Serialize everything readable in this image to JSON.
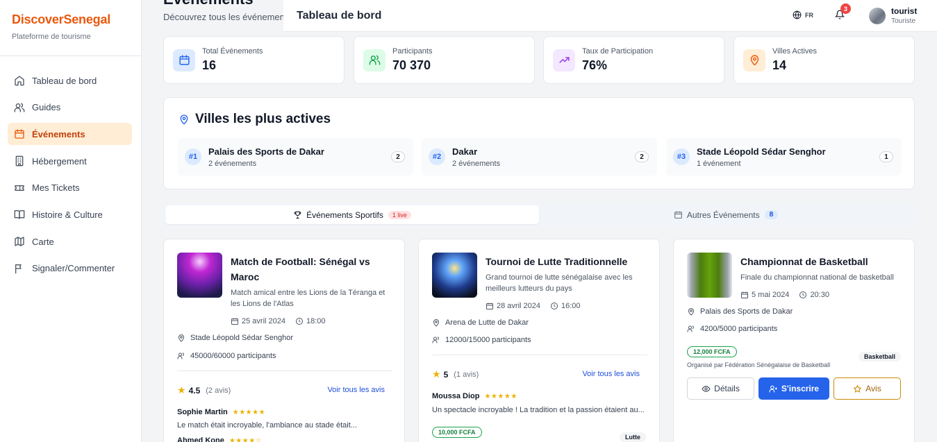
{
  "brand": {
    "title": "DiscoverSenegal",
    "subtitle": "Plateforme de tourisme"
  },
  "sidebar": {
    "items": [
      {
        "label": "Tableau de bord",
        "icon": "home-icon",
        "active": false
      },
      {
        "label": "Guides",
        "icon": "users-icon",
        "active": false
      },
      {
        "label": "Événements",
        "icon": "calendar-icon",
        "active": true
      },
      {
        "label": "Hébergement",
        "icon": "building-icon",
        "active": false
      },
      {
        "label": "Mes Tickets",
        "icon": "ticket-icon",
        "active": false
      },
      {
        "label": "Histoire & Culture",
        "icon": "book-icon",
        "active": false
      },
      {
        "label": "Carte",
        "icon": "map-icon",
        "active": false
      },
      {
        "label": "Signaler/Commenter",
        "icon": "flag-icon",
        "active": false
      }
    ]
  },
  "page": {
    "title": "Événements",
    "subtitle": "Découvrez tous les événements"
  },
  "header": {
    "title": "Tableau de bord",
    "language": "FR",
    "notifications": "3",
    "user": {
      "name": "tourist",
      "role": "Touriste"
    }
  },
  "stats": [
    {
      "label": "Total Événements",
      "value": "16",
      "icon": "calendar-icon",
      "color": "#2563eb",
      "bg": "#dbeafe"
    },
    {
      "label": "Participants",
      "value": "70 370",
      "icon": "users-icon",
      "color": "#16a34a",
      "bg": "#dcfce7"
    },
    {
      "label": "Taux de Participation",
      "value": "76%",
      "icon": "trending-up-icon",
      "color": "#9333ea",
      "bg": "#f3e8ff"
    },
    {
      "label": "Villes Actives",
      "value": "14",
      "icon": "map-pin-icon",
      "color": "#ea580c",
      "bg": "#ffedd5"
    }
  ],
  "cities": {
    "title": "Villes les plus actives",
    "items": [
      {
        "rank": "#1",
        "name": "Palais des Sports de Dakar",
        "events": "2 événements",
        "count": "2"
      },
      {
        "rank": "#2",
        "name": "Dakar",
        "events": "2 événements",
        "count": "2"
      },
      {
        "rank": "#3",
        "name": "Stade Léopold Sédar Senghor",
        "events": "1 événement",
        "count": "1"
      }
    ]
  },
  "tabs": {
    "sports": {
      "label": "Événements Sportifs",
      "badge": "1 live"
    },
    "others": {
      "label": "Autres Événements",
      "badge": "8"
    }
  },
  "events": [
    {
      "title": "Match de Football: Sénégal vs Maroc",
      "description": "Match amical entre les Lions de la Téranga et les Lions de l'Atlas",
      "date": "25 avril 2024",
      "time": "18:00",
      "venue": "Stade Léopold Sédar Senghor",
      "participants": "45000/60000 participants",
      "rating": "4.5",
      "reviews_count": "(2 avis)",
      "see_all": "Voir tous les avis",
      "reviews": [
        {
          "name": "Sophie Martin",
          "stars": "★★★★★",
          "text": "Le match était incroyable, l'ambiance au stade était..."
        },
        {
          "name": "Ahmed Kone",
          "stars": "★★★★☆",
          "text": ""
        }
      ]
    },
    {
      "title": "Tournoi de Lutte Traditionnelle",
      "description": "Grand tournoi de lutte sénégalaise avec les meilleurs lutteurs du pays",
      "date": "28 avril 2024",
      "time": "16:00",
      "venue": "Arena de Lutte de Dakar",
      "participants": "12000/15000 participants",
      "rating": "5",
      "reviews_count": "(1 avis)",
      "see_all": "Voir tous les avis",
      "reviews": [
        {
          "name": "Moussa Diop",
          "stars": "★★★★★",
          "text": "Un spectacle incroyable ! La tradition et la passion étaient au..."
        }
      ],
      "price": "10,000 FCFA",
      "category": "Lutte"
    },
    {
      "title": "Championnat de Basketball",
      "description": "Finale du championnat national de basketball",
      "date": "5 mai 2024",
      "time": "20:30",
      "venue": "Palais des Sports de Dakar",
      "participants": "4200/5000 participants",
      "price": "12,000 FCFA",
      "organizer": "Organisé par Fédération Sénégalaise de Basketball",
      "category": "Basketball",
      "buttons": {
        "details": "Détails",
        "register": "S'inscrire",
        "review": "Avis"
      }
    }
  ]
}
